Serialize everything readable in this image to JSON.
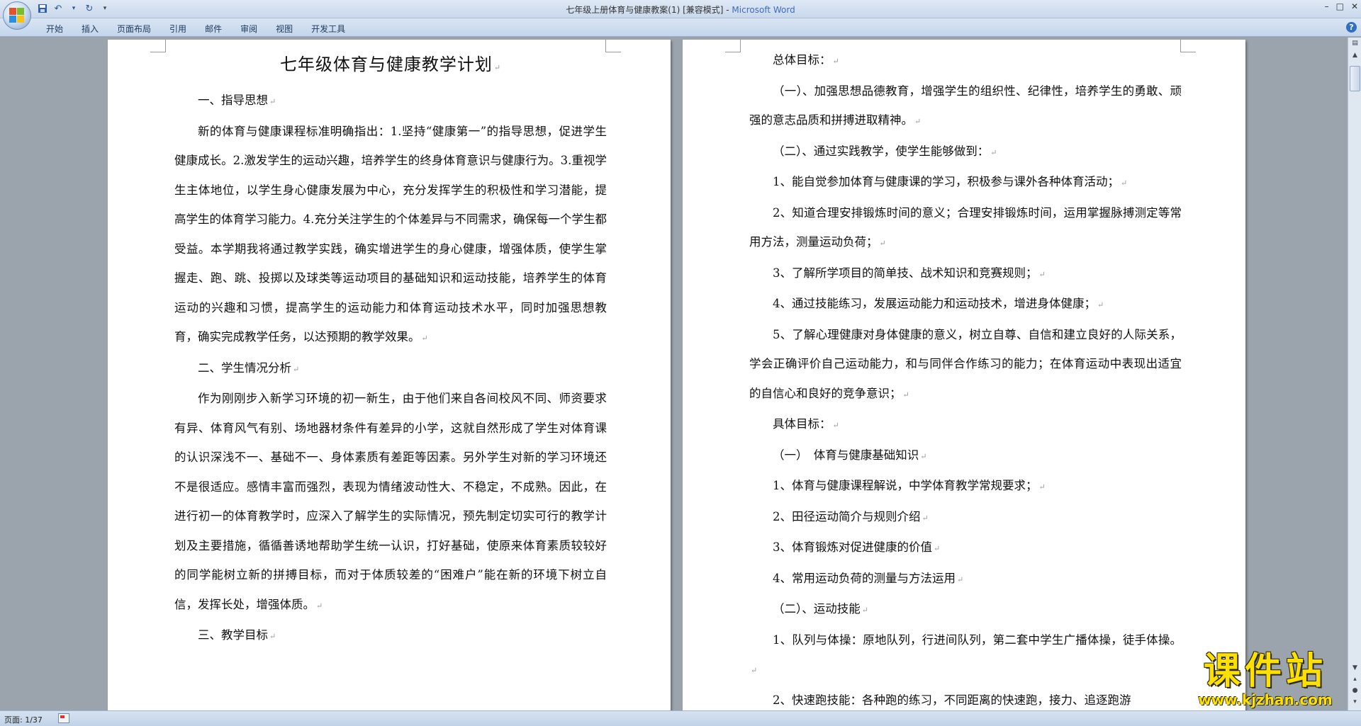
{
  "window": {
    "title": "七年级上册体育与健康教案(1) [兼容模式] - ",
    "app_name": "Microsoft Word",
    "controls": [
      "minimize-icon",
      "maximize-icon",
      "close-icon"
    ]
  },
  "quick_access": [
    "save-icon",
    "undo-icon",
    "redo-icon",
    "customize-icon"
  ],
  "ribbon": {
    "tabs": [
      "开始",
      "插入",
      "页面布局",
      "引用",
      "邮件",
      "审阅",
      "视图",
      "开发工具"
    ]
  },
  "left_page": {
    "title": "七年级体育与健康教学计划",
    "paragraphs": [
      "一、指导思想",
      "新的体育与健康课程标准明确指出：1.坚持“健康第一”的指导思想，促进学生健康成长。2.激发学生的运动兴趣，培养学生的终身体育意识与健康行为。3.重视学生主体地位，以学生身心健康发展为中心，充分发挥学生的积极性和学习潜能，提高学生的体育学习能力。4.充分关注学生的个体差异与不同需求，确保每一个学生都受益。本学期我将通过教学实践，确实增进学生的身心健康，增强体质，使学生掌握走、跑、跳、投掷以及球类等运动项目的基础知识和运动技能，培养学生的体育运动的兴趣和习惯，提高学生的运动能力和体育运动技术水平，同时加强思想教育，确实完成教学任务，以达预期的教学效果。",
      "二、学生情况分析",
      "作为刚刚步入新学习环境的初一新生，由于他们来自各间校风不同、师资要求有异、体育风气有别、场地器材条件有差异的小学，这就自然形成了学生对体育课的认识深浅不一、基础不一、身体素质有差距等因素。另外学生对新的学习环境还不是很适应。感情丰富而强烈，表现为情绪波动性大、不稳定，不成熟。因此，在进行初一的体育教学时，应深入了解学生的实际情况，预先制定切实可行的教学计划及主要措施，循循善诱地帮助学生统一认识，打好基础，使原来体育素质较较好的同学能树立新的拼搏目标，而对于体质较差的“困难户”能在新的环境下树立自信，发挥长处，增强体质。",
      "三、教学目标"
    ]
  },
  "right_page": {
    "paragraphs": [
      "总体目标：",
      "（一）、加强思想品德教育，增强学生的组织性、纪律性，培养学生的勇敢、顽强的意志品质和拼搏进取精神。",
      "（二）、通过实践教学，使学生能够做到：",
      "1、能自觉参加体育与健康课的学习，积极参与课外各种体育活动；",
      "2、知道合理安排锻炼时间的意义；合理安排锻炼时间，运用掌握脉搏测定等常用方法，测量运动负荷；",
      "3、了解所学项目的简单技、战术知识和竞赛规则；",
      "4、通过技能练习，发展运动能力和运动技术，增进身体健康；",
      "5、了解心理健康对身体健康的意义，树立自尊、自信和建立良好的人际关系，学会正确评价自己运动能力，和与同伴合作练习的能力；在体育运动中表现出适宜的自信心和良好的竞争意识；",
      "具体目标：",
      "（一）　体育与健康基础知识",
      "1、体育与健康课程解说，中学体育教学常规要求；",
      "2、田径运动简介与规则介绍",
      "3、体育锻炼对促进健康的价值",
      "4、常用运动负荷的测量与方法运用",
      "（二）、运动技能",
      "1、队列与体操：原地队列，行进间队列，第二套中学生广播体操，徒手体操。",
      "2、快速跑技能：各种跑的练习，不同距离的快速跑，接力、追逐跑游"
    ],
    "last_no_mark": true
  },
  "paragraph_mark": "↵",
  "status": {
    "page": "页面: 1/37"
  },
  "watermark": {
    "main": "课件站",
    "url": "www.kjzhan.com"
  }
}
